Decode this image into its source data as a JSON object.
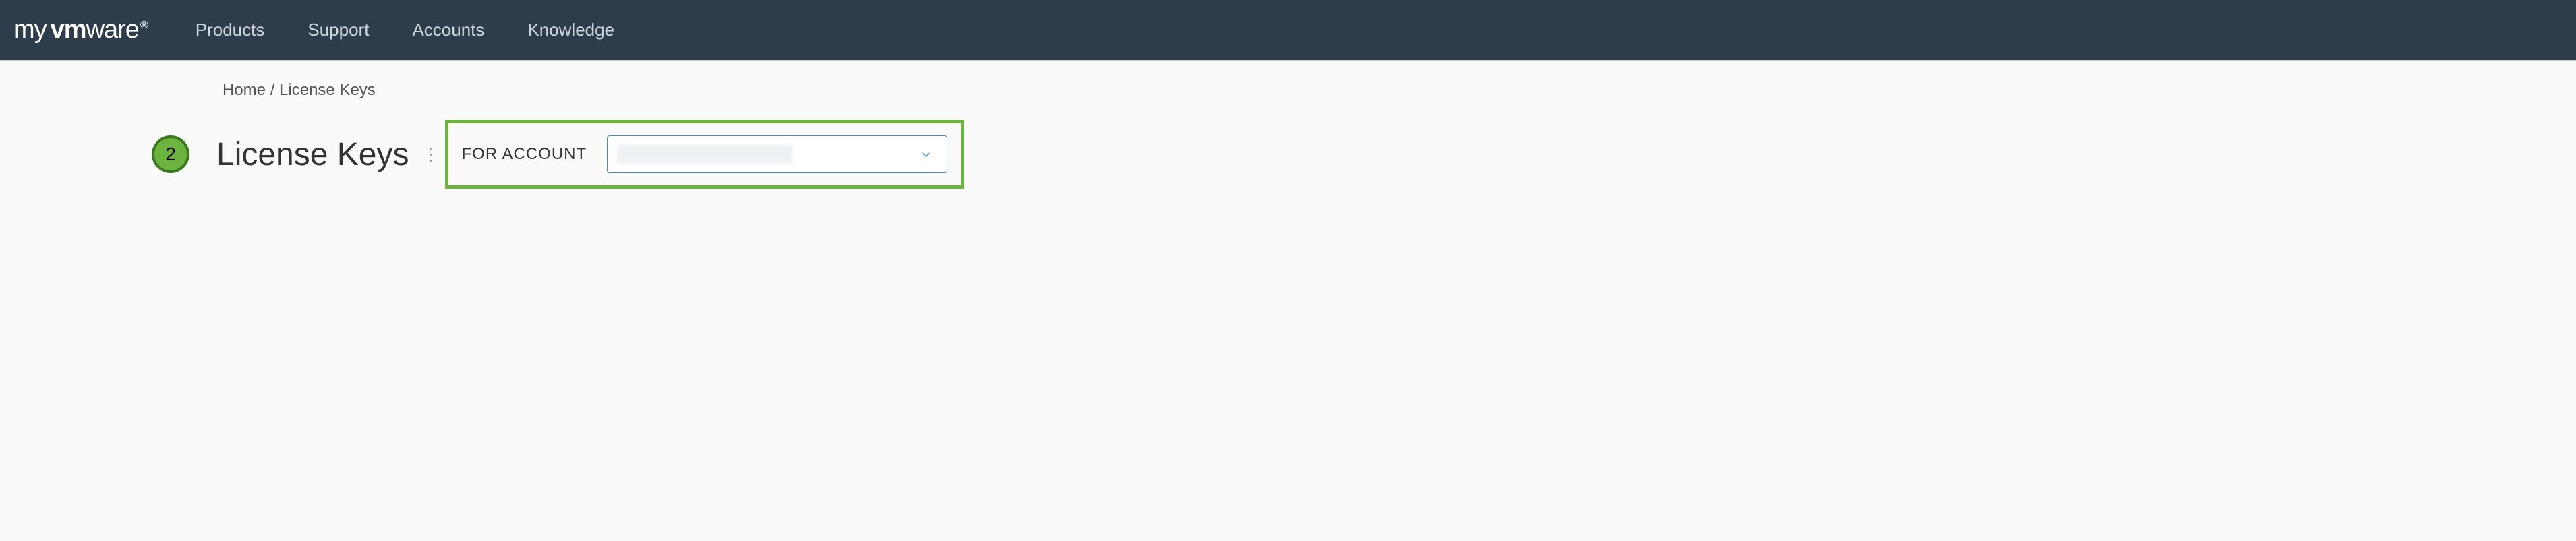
{
  "brand": {
    "prefix": "my",
    "name": "vmware"
  },
  "nav": {
    "items": [
      {
        "label": "Products"
      },
      {
        "label": "Support"
      },
      {
        "label": "Accounts"
      },
      {
        "label": "Knowledge"
      }
    ]
  },
  "breadcrumb": {
    "home": "Home",
    "sep": " / ",
    "current": "License Keys"
  },
  "step": {
    "number": "2"
  },
  "page": {
    "title": "License Keys"
  },
  "account": {
    "label": "FOR ACCOUNT",
    "selected": ""
  }
}
